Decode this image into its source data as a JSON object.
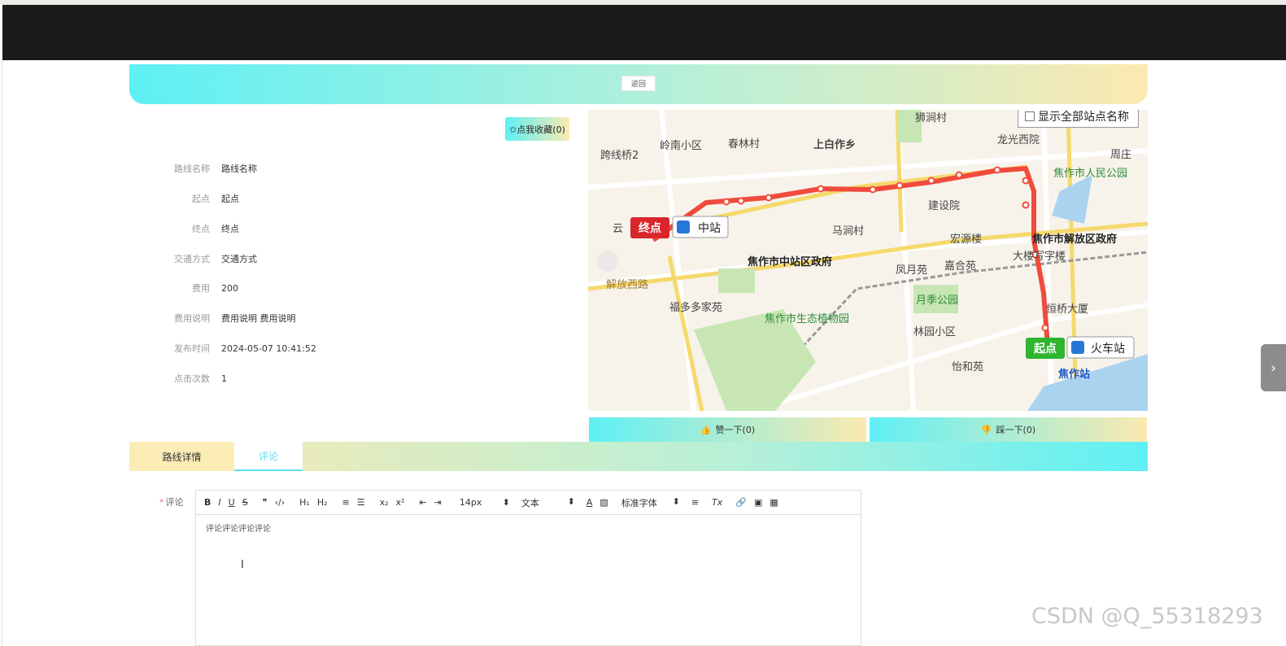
{
  "header": {
    "back_label": "返回"
  },
  "favorite": {
    "label": "✩点我收藏(0)"
  },
  "route_info": [
    {
      "label": "路线名称",
      "value": "路线名称"
    },
    {
      "label": "起点",
      "value": "起点"
    },
    {
      "label": "终点",
      "value": "终点"
    },
    {
      "label": "交通方式",
      "value": "交通方式"
    },
    {
      "label": "费用",
      "value": "200"
    },
    {
      "label": "费用说明",
      "value": "费用说明 费用说明"
    },
    {
      "label": "发布时间",
      "value": "2024-05-07 10:41:52"
    },
    {
      "label": "点击次数",
      "value": "1"
    }
  ],
  "map": {
    "show_all_label": "显示全部站点名称",
    "start_marker": "起点",
    "start_station": "火车站",
    "end_marker": "终点",
    "end_station": "中站",
    "place_names": {
      "p1": "跨线桥2",
      "p2": "岭南小区",
      "p3": "春林村",
      "p4": "上白作乡",
      "p5": "狮涧村",
      "p6": "龙光西院",
      "p7": "周庄",
      "p8": "焦作市人民公园",
      "p9": "建设院",
      "p10": "马涧村",
      "p11": "宏源楼",
      "p12": "焦作市解放区政府",
      "p13": "焦作市中站区政府",
      "p14": "凤月苑",
      "p15": "嘉合苑",
      "p16": "大楼写字楼",
      "p17": "解放西路",
      "p18": "福多多家苑",
      "p19": "焦作市生态植物园",
      "p20": "月季公园",
      "p21": "恒桥大厦",
      "p22": "林园小区",
      "p23": "怡和苑",
      "p24": "焦作站",
      "p25": "云"
    },
    "route_color": "#f04b3c"
  },
  "votes": {
    "up_label": "赞一下(0)",
    "down_label": "踩一下(0)"
  },
  "tabs": [
    {
      "label": "路线详情",
      "active": false
    },
    {
      "label": "评论",
      "active": true
    }
  ],
  "comment": {
    "label": "评论",
    "required_mark": "*",
    "text": "评论评论评论评论",
    "toolbar": {
      "bold": "B",
      "italic": "I",
      "underline": "U",
      "strike": "S",
      "blockquote": "❞",
      "code": "‹/›",
      "h1": "H₁",
      "h2": "H₂",
      "ordered_list": "≡",
      "bullet_list": "☰",
      "subscript": "x₂",
      "superscript": "x²",
      "outdent": "⇤",
      "indent": "⇥",
      "size": "14px",
      "format": "文本",
      "font": "标准字体",
      "align": "≡",
      "clear": "Tx",
      "link": "🔗",
      "image": "▣",
      "video": "▦"
    }
  },
  "watermark": "CSDN @Q_55318293",
  "colors": {
    "accent_cyan": "#5ef0f5",
    "accent_yellow": "#fbe9b0",
    "route": "#f04b3c",
    "start_green": "#2fb52f",
    "end_red": "#d9262b"
  }
}
